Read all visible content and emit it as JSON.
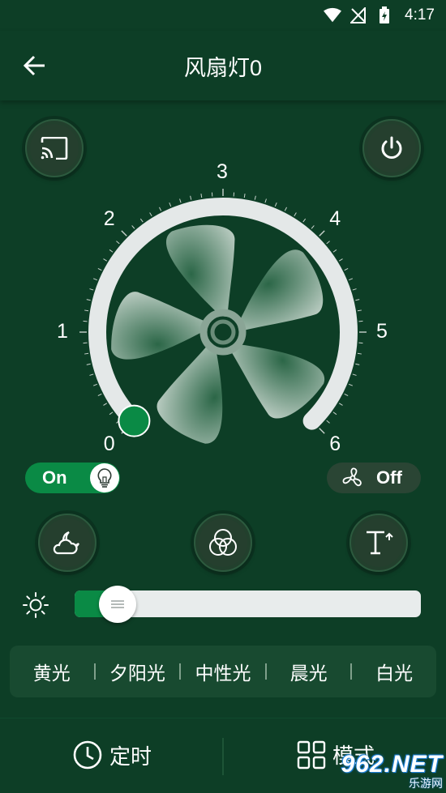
{
  "status_bar": {
    "time": "4:17"
  },
  "header": {
    "title": "风扇灯0"
  },
  "dial": {
    "labels": [
      "0",
      "1",
      "2",
      "3",
      "4",
      "5",
      "6"
    ],
    "current_level": 0
  },
  "light_toggle": {
    "label": "On",
    "state": "on"
  },
  "fan_toggle": {
    "label": "Off",
    "state": "off"
  },
  "brightness": {
    "level_percent": 10
  },
  "color_temperature": {
    "options": [
      "黄光",
      "夕阳光",
      "中性光",
      "晨光",
      "白光"
    ]
  },
  "bottom_nav": {
    "timer_label": "定时",
    "mode_label": "模式"
  },
  "watermark": {
    "main": "962.NET",
    "sub": "乐游网"
  },
  "colors": {
    "background": "#0d3e26",
    "accent_green": "#0a8a45",
    "button_dark": "#22402d",
    "track_light": "#e8ecec"
  }
}
